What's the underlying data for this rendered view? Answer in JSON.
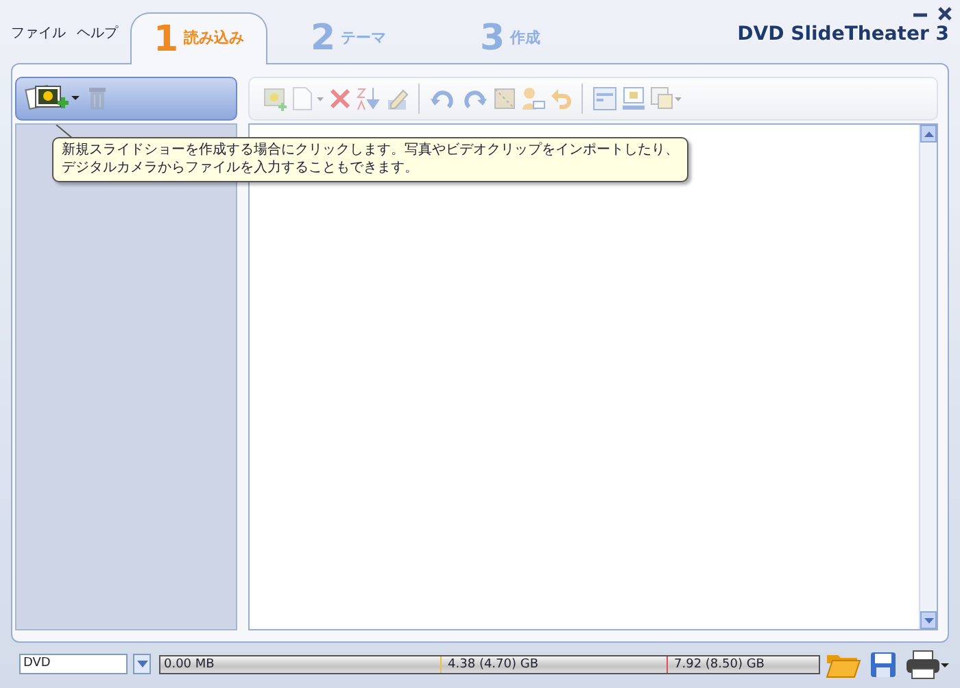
{
  "menu": [
    "ファイル",
    "ヘルプ"
  ],
  "window_controls": [
    {
      "kind": "minimize"
    },
    {
      "kind": "close"
    }
  ],
  "tabs": [
    {
      "number": "1",
      "label": "読み込み",
      "selected": true
    },
    {
      "number": "2",
      "label": "テーマ",
      "selected": false
    },
    {
      "number": "3",
      "label": "作成",
      "selected": false
    }
  ],
  "app_title": "DVD SlideTheater 3",
  "left_toolbar": [
    {
      "kind": "add-photos",
      "disabled": false
    },
    {
      "kind": "trash",
      "disabled": true
    }
  ],
  "toolbar": [
    [
      {
        "kind": "image-add",
        "disabled": true
      },
      {
        "kind": "page",
        "disabled": true
      },
      {
        "kind": "delete",
        "disabled": true
      },
      {
        "kind": "sort",
        "disabled": true
      },
      {
        "kind": "edit",
        "disabled": true
      }
    ],
    [
      {
        "kind": "rotate-left",
        "disabled": true
      },
      {
        "kind": "rotate-right",
        "disabled": true
      },
      {
        "kind": "crop",
        "disabled": true
      },
      {
        "kind": "person",
        "disabled": true
      },
      {
        "kind": "undo",
        "disabled": true
      }
    ],
    [
      {
        "kind": "layout",
        "disabled": true
      },
      {
        "kind": "monitor",
        "disabled": true
      },
      {
        "kind": "export",
        "disabled": true
      }
    ]
  ],
  "tooltip": {
    "lines": [
      "新規スライドショーを作成する場合にクリックします。写真やビデオクリップをインポートしたり、",
      "デジタルカメラからファイルを入力することもできます。"
    ]
  },
  "footer": {
    "disc_type": "DVD",
    "used": "0.00 MB",
    "marks": [
      {
        "label": "4.38 (4.70) GB",
        "color": "#f0c040"
      },
      {
        "label": "7.92 (8.50) GB",
        "color": "#e05050"
      }
    ],
    "buttons": [
      {
        "kind": "open"
      },
      {
        "kind": "save"
      },
      {
        "kind": "print"
      }
    ]
  }
}
